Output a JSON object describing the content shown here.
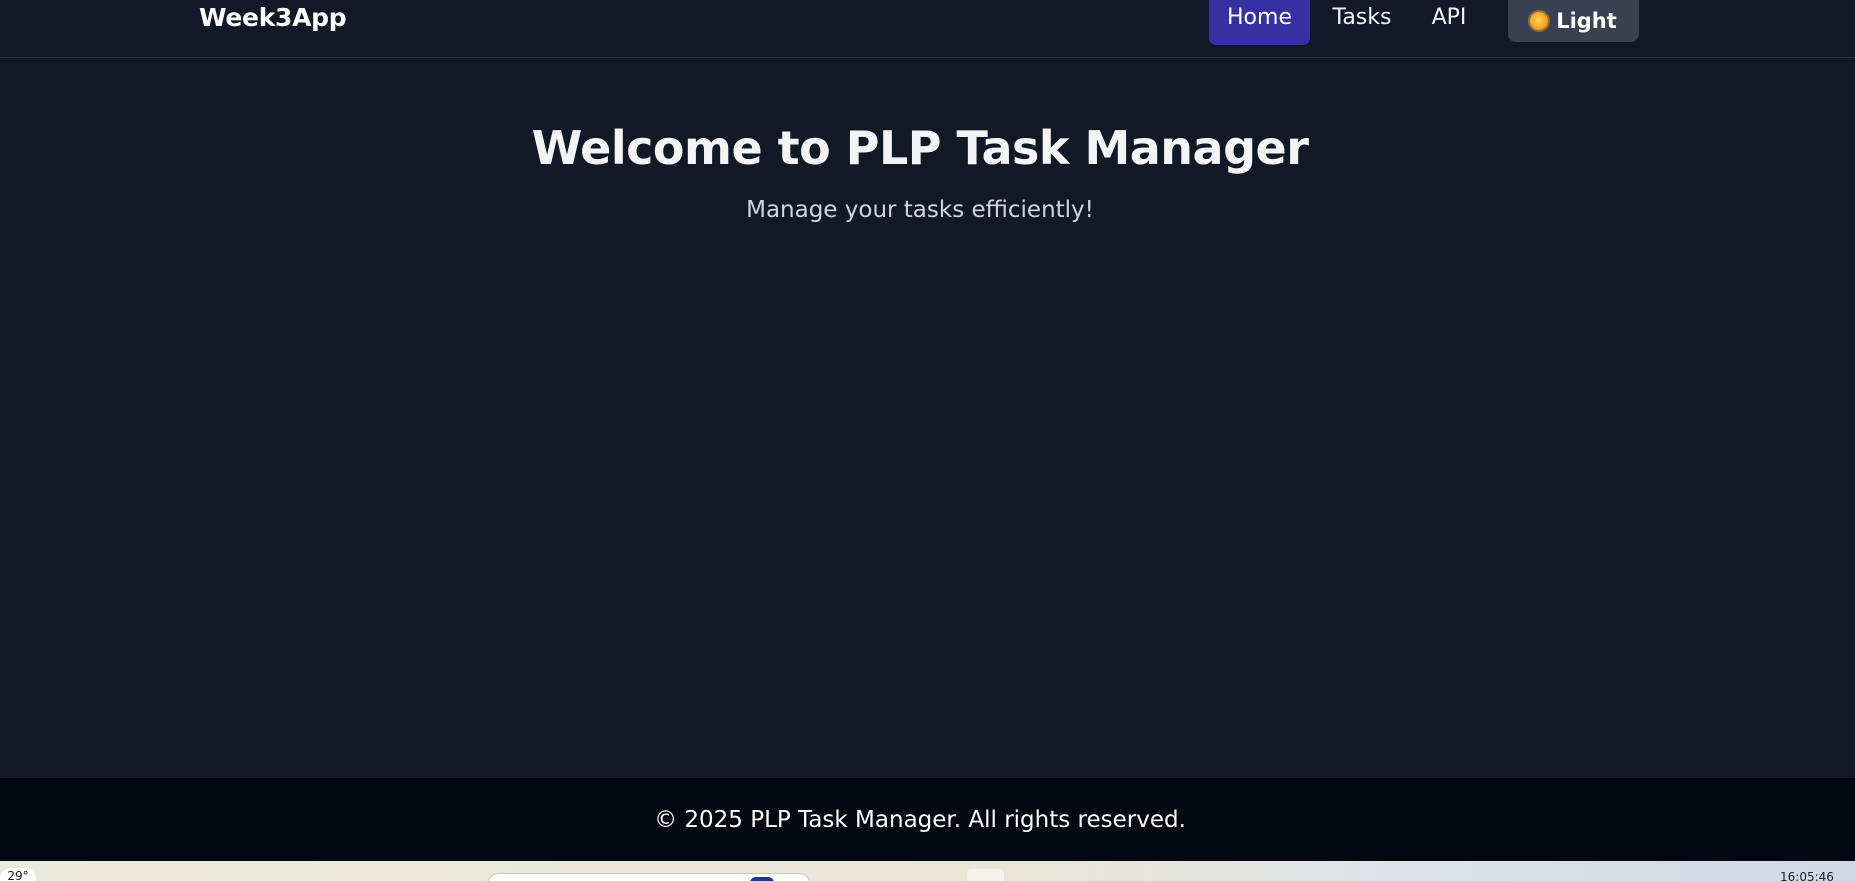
{
  "navbar": {
    "brand": "Week3App",
    "links": [
      {
        "label": "Home",
        "active": true
      },
      {
        "label": "Tasks",
        "active": false
      },
      {
        "label": "API",
        "active": false
      }
    ],
    "theme_toggle": {
      "icon": "sun-icon",
      "label": "Light"
    }
  },
  "hero": {
    "title": "Welcome to PLP Task Manager",
    "subtitle": "Manage your tasks efficiently!"
  },
  "footer": {
    "text": "© 2025 PLP Task Manager. All rights reserved."
  },
  "taskbar": {
    "weather": "29°",
    "clock": "16:05:46"
  },
  "colors": {
    "background": "#121826",
    "navbar": "#111827",
    "active_link": "#3730a3",
    "toggle": "#374151",
    "footer": "#030712"
  }
}
